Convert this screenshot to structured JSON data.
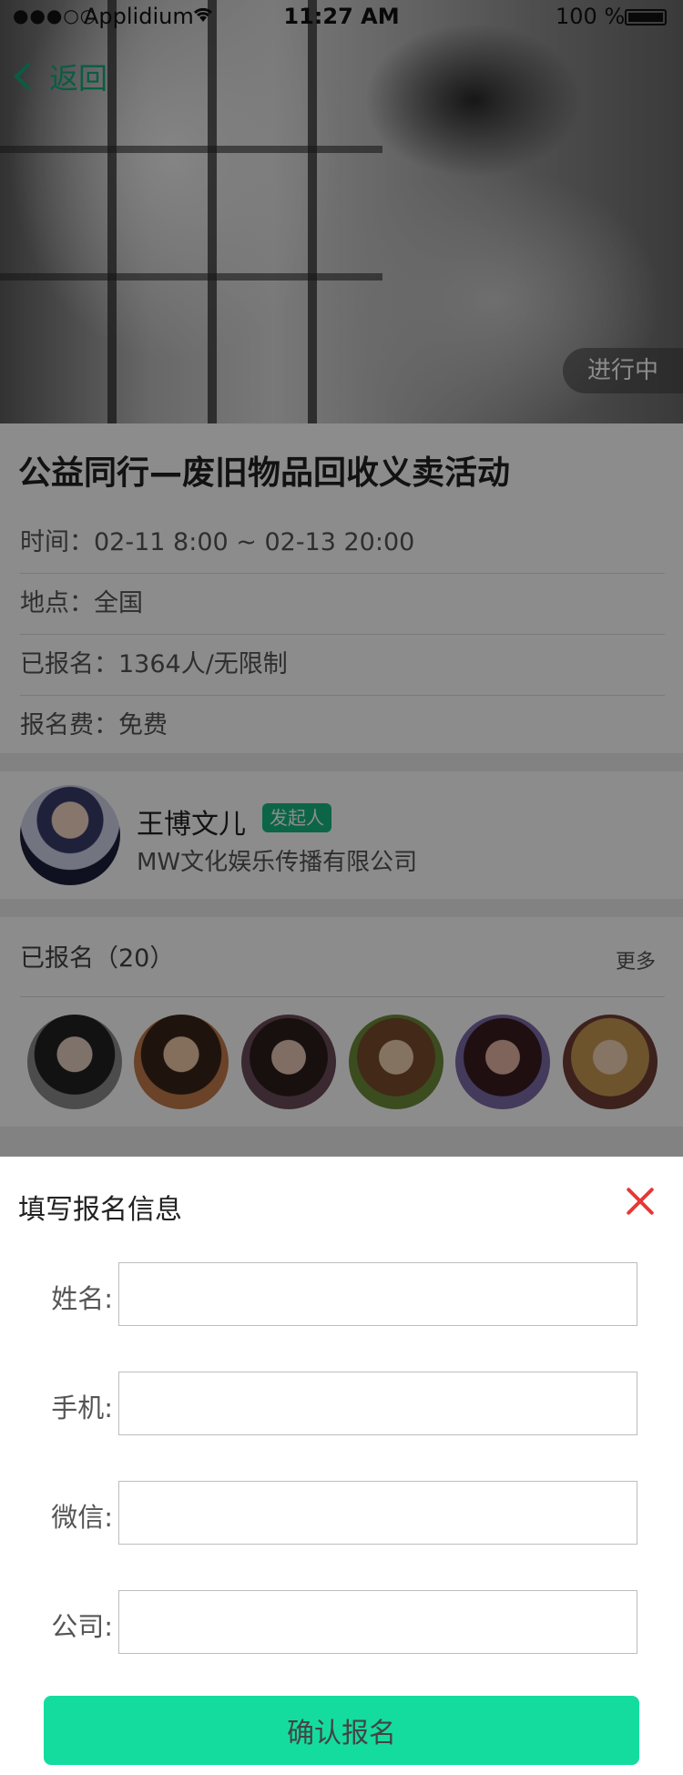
{
  "status_bar": {
    "signal": "●●●○○",
    "carrier": "Applidium",
    "time": "11:27 AM",
    "battery": "100 %"
  },
  "header": {
    "back_label": "返回"
  },
  "hero": {
    "status_tag": "进行中"
  },
  "event": {
    "title": "公益同行—废旧物品回收义卖活动",
    "time": "时间：02-11 8:00 ~ 02-13 20:00",
    "location": "地点：全国",
    "registered": "已报名：1364人/无限制",
    "fee": "报名费：免费"
  },
  "organizer": {
    "name": "王博文儿",
    "badge": "发起人",
    "company": "MW文化娱乐传播有限公司"
  },
  "signups": {
    "title": "已报名（20）",
    "more": "更多"
  },
  "form": {
    "title": "填写报名信息",
    "fields": [
      {
        "label": "姓名:",
        "value": ""
      },
      {
        "label": "手机:",
        "value": ""
      },
      {
        "label": "微信:",
        "value": ""
      },
      {
        "label": "公司:",
        "value": ""
      }
    ],
    "submit": "确认报名"
  },
  "colors": {
    "accent": "#14dc9f",
    "badge": "#16b981",
    "back": "#16a77a",
    "close": "#e53935"
  }
}
